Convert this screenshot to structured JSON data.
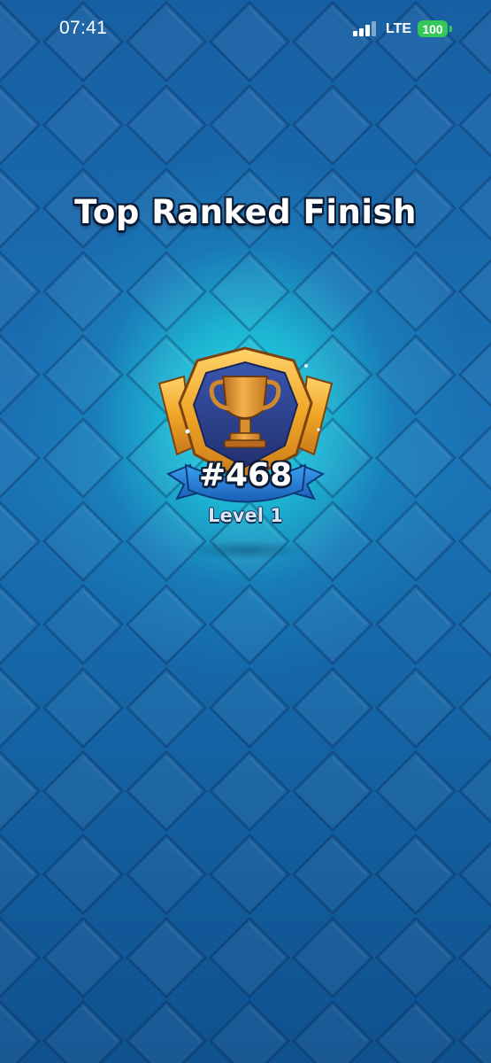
{
  "status_bar": {
    "time": "07:41",
    "network": "LTE",
    "battery": "100",
    "battery_color": "#34c759"
  },
  "screen": {
    "title": "Top Ranked Finish",
    "rank": "#468",
    "level": "Level 1",
    "badge_icon": "trophy-icon",
    "colors": {
      "background": "#1a6cb0",
      "glow": "#28ebf0",
      "badge_gold": "#f0a526",
      "badge_inner": "#2c3f8f",
      "ribbon": "#2a7fd6"
    }
  }
}
